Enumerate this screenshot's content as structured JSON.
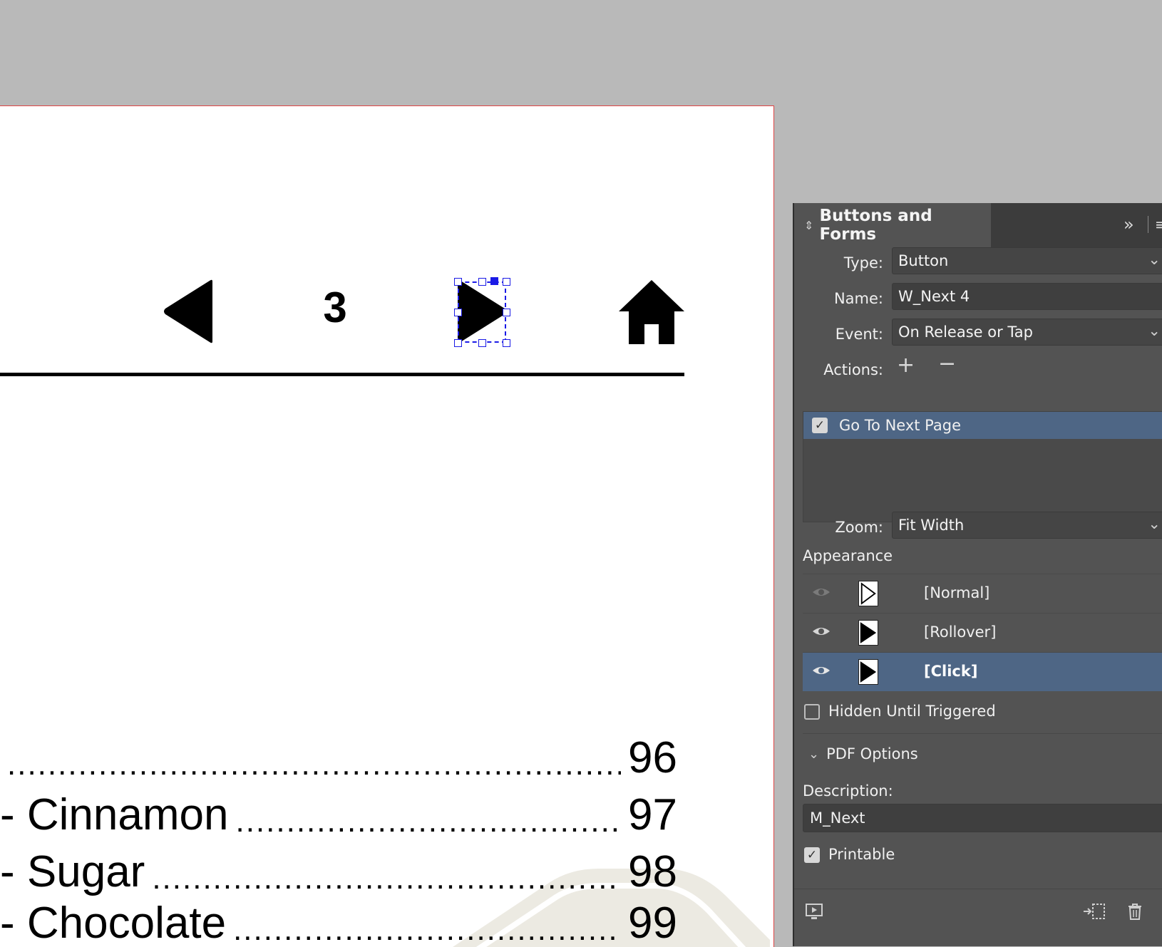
{
  "document": {
    "page_number": "3",
    "toc": [
      {
        "lead": "",
        "page": "96"
      },
      {
        "lead": "- Cinnamon",
        "page": "97"
      },
      {
        "lead": "- Sugar",
        "page": "98"
      },
      {
        "lead": "- Chocolate",
        "page": "99"
      }
    ]
  },
  "panel": {
    "title": "Buttons and Forms",
    "type_label": "Type:",
    "type_value": "Button",
    "name_label": "Name:",
    "name_value": "W_Next 4",
    "event_label": "Event:",
    "event_value": "On Release or Tap",
    "actions_label": "Actions:",
    "action_item": "Go To Next Page",
    "zoom_label": "Zoom:",
    "zoom_value": "Fit Width",
    "appearance_label": "Appearance",
    "states": [
      "[Normal]",
      "[Rollover]",
      "[Click]"
    ],
    "hidden_label": "Hidden Until Triggered",
    "pdf_options_label": "PDF Options",
    "description_label": "Description:",
    "description_value": "M_Next",
    "printable_label": "Printable"
  },
  "colors": {
    "canvas_bg": "#b9b9b9",
    "panel_bg": "#535353",
    "selection": "#4e6685",
    "frame_selection": "#1a1ae6"
  }
}
